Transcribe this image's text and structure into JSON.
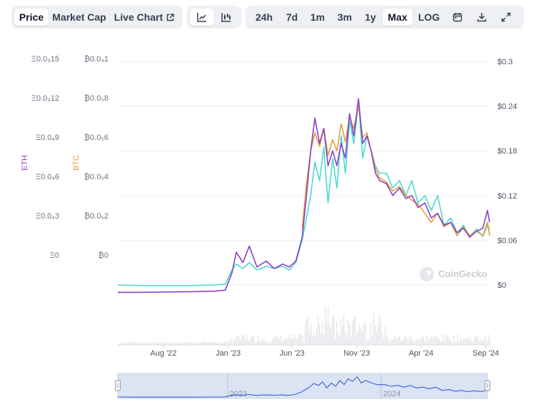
{
  "toolbar": {
    "tabs": [
      {
        "label": "Price",
        "active": true
      },
      {
        "label": "Market Cap",
        "active": false
      },
      {
        "label": "Live Chart",
        "active": false
      }
    ],
    "chart_types": [
      "line-chart-icon",
      "candlestick-icon"
    ],
    "ranges": [
      {
        "label": "24h",
        "active": false
      },
      {
        "label": "7d",
        "active": false
      },
      {
        "label": "1m",
        "active": false
      },
      {
        "label": "3m",
        "active": false
      },
      {
        "label": "1y",
        "active": false
      },
      {
        "label": "Max",
        "active": true
      },
      {
        "label": "LOG",
        "active": false
      }
    ],
    "tools": [
      "calendar-icon",
      "download-icon",
      "expand-icon"
    ]
  },
  "watermark": "CoinGecko",
  "colors": {
    "eth": "#8b3fc9",
    "btc": "#e0a03c",
    "usd": "#4dd9d0",
    "volume": "#e3e6ea",
    "navigator_fill": "#dbe4f3",
    "navigator_line": "#3d5bd9"
  },
  "chart_data": {
    "type": "line",
    "x_labels": [
      "Aug '22",
      "Jan '23",
      "Jun '23",
      "Nov '23",
      "Apr '24",
      "Sep '24"
    ],
    "x_label_positions": [
      "2022-08-01",
      "2023-01-01",
      "2023-06-01",
      "2023-11-01",
      "2024-04-01",
      "2024-09-01"
    ],
    "x_range": [
      "2022-04-15",
      "2024-09-10"
    ],
    "y_axis_usd": {
      "ticks": [
        "$0",
        "$0.06",
        "$0.12",
        "$0.18",
        "$0.24",
        "$0.3"
      ],
      "range": [
        0,
        0.3
      ]
    },
    "y_axis_btc": {
      "title": "BTC",
      "ticks": [
        "₿0",
        "₿0.0₅2",
        "₿0.0₅4",
        "₿0.0₅6",
        "₿0.0₅8",
        "₿0.0₄1"
      ],
      "range": [
        0,
        1e-05
      ]
    },
    "y_axis_eth": {
      "title": "ETH",
      "ticks": [
        "Ξ0",
        "Ξ0.0₄3",
        "Ξ0.0₄6",
        "Ξ0.0₄9",
        "Ξ0.0₃12",
        "Ξ0.0₃15"
      ],
      "range": [
        0,
        0.00015
      ]
    },
    "series": [
      {
        "name": "USD",
        "axis": "usd",
        "x": [
          "2022-04-15",
          "2022-06-01",
          "2022-08-01",
          "2022-10-01",
          "2022-12-01",
          "2022-12-25",
          "2023-01-10",
          "2023-01-20",
          "2023-02-05",
          "2023-02-20",
          "2023-03-10",
          "2023-04-01",
          "2023-04-20",
          "2023-05-10",
          "2023-05-25",
          "2023-06-10",
          "2023-06-25",
          "2023-07-05",
          "2023-07-15",
          "2023-07-25",
          "2023-08-05",
          "2023-08-15",
          "2023-08-25",
          "2023-09-05",
          "2023-09-15",
          "2023-09-25",
          "2023-10-05",
          "2023-10-15",
          "2023-10-25",
          "2023-11-05",
          "2023-11-15",
          "2023-11-25",
          "2023-12-05",
          "2023-12-15",
          "2023-12-25",
          "2024-01-10",
          "2024-01-25",
          "2024-02-10",
          "2024-02-25",
          "2024-03-10",
          "2024-03-25",
          "2024-04-10",
          "2024-04-25",
          "2024-05-10",
          "2024-05-25",
          "2024-06-10",
          "2024-06-25",
          "2024-07-10",
          "2024-07-25",
          "2024-08-10",
          "2024-08-25",
          "2024-09-05",
          "2024-09-10"
        ],
        "y": [
          0.0,
          -0.001,
          -0.001,
          -0.001,
          0.0,
          0.001,
          0.02,
          0.028,
          0.022,
          0.03,
          0.02,
          0.025,
          0.022,
          0.025,
          0.02,
          0.03,
          0.06,
          0.09,
          0.12,
          0.165,
          0.14,
          0.185,
          0.11,
          0.17,
          0.13,
          0.2,
          0.15,
          0.22,
          0.19,
          0.245,
          0.17,
          0.2,
          0.18,
          0.16,
          0.15,
          0.15,
          0.13,
          0.14,
          0.12,
          0.14,
          0.11,
          0.12,
          0.1,
          0.12,
          0.08,
          0.09,
          0.07,
          0.08,
          0.065,
          0.075,
          0.065,
          0.08,
          0.075
        ]
      },
      {
        "name": "BTC",
        "axis": "btc",
        "x": [
          "2023-06-25",
          "2023-07-05",
          "2023-07-15",
          "2023-07-25",
          "2023-08-05",
          "2023-08-15",
          "2023-08-25",
          "2023-09-05",
          "2023-09-15",
          "2023-09-25",
          "2023-10-05",
          "2023-10-15",
          "2023-10-25",
          "2023-11-05",
          "2023-11-15",
          "2023-11-25",
          "2023-12-05",
          "2023-12-15",
          "2023-12-25",
          "2024-01-10",
          "2024-01-25",
          "2024-02-10",
          "2024-02-25",
          "2024-03-10",
          "2024-03-25",
          "2024-04-10",
          "2024-04-25",
          "2024-05-10",
          "2024-05-25",
          "2024-06-10",
          "2024-06-25",
          "2024-07-10",
          "2024-07-25",
          "2024-08-10",
          "2024-08-25",
          "2024-09-05",
          "2024-09-10"
        ],
        "y": [
          2.5e-06,
          4.5e-06,
          6e-06,
          6.8e-06,
          6.2e-06,
          7e-06,
          5.8e-06,
          6.5e-06,
          6e-06,
          7.2e-06,
          6.4e-06,
          7.5e-06,
          7e-06,
          8e-06,
          6.6e-06,
          6.8e-06,
          6e-06,
          5.2e-06,
          4.8e-06,
          4.6e-06,
          4.2e-06,
          4.4e-06,
          4e-06,
          3.8e-06,
          3.6e-06,
          3.2e-06,
          2.8e-06,
          3.2e-06,
          2.6e-06,
          2.8e-06,
          2.2e-06,
          2.6e-06,
          2.2e-06,
          2.4e-06,
          2.2e-06,
          2.8e-06,
          2.2e-06
        ]
      },
      {
        "name": "ETH",
        "axis": "eth",
        "x": [
          "2022-04-15",
          "2022-06-01",
          "2022-08-01",
          "2022-10-01",
          "2022-12-01",
          "2022-12-25",
          "2023-01-10",
          "2023-01-20",
          "2023-02-05",
          "2023-02-20",
          "2023-03-10",
          "2023-04-01",
          "2023-04-20",
          "2023-05-10",
          "2023-05-25",
          "2023-06-10",
          "2023-06-25",
          "2023-07-05",
          "2023-07-15",
          "2023-07-25",
          "2023-08-05",
          "2023-08-15",
          "2023-08-25",
          "2023-09-05",
          "2023-09-15",
          "2023-09-25",
          "2023-10-05",
          "2023-10-15",
          "2023-10-25",
          "2023-11-05",
          "2023-11-15",
          "2023-11-25",
          "2023-12-05",
          "2023-12-15",
          "2023-12-25",
          "2024-01-10",
          "2024-01-25",
          "2024-02-10",
          "2024-02-25",
          "2024-03-10",
          "2024-03-25",
          "2024-04-10",
          "2024-04-25",
          "2024-05-10",
          "2024-05-25",
          "2024-06-10",
          "2024-06-25",
          "2024-07-10",
          "2024-07-25",
          "2024-08-10",
          "2024-08-25",
          "2024-09-05",
          "2024-09-10"
        ],
        "y": [
          -5e-06,
          -5e-06,
          -4.8e-06,
          -4.6e-06,
          -4.2e-06,
          -3.5e-06,
          8e-06,
          2.2e-05,
          1.5e-05,
          2.6e-05,
          1.2e-05,
          1.6e-05,
          1.1e-05,
          1.4e-05,
          1.2e-05,
          1.6e-05,
          3.2e-05,
          6e-05,
          9e-05,
          0.000112,
          9.5e-05,
          0.000105,
          8e-05,
          9e-05,
          8e-05,
          9.5e-05,
          8.5e-05,
          0.000115,
          0.0001,
          0.000125,
          9.5e-05,
          0.0001,
          9e-05,
          7.5e-05,
          7e-05,
          6.8e-05,
          6e-05,
          6.5e-05,
          5.8e-05,
          6e-05,
          5.2e-05,
          5.5e-05,
          4.5e-05,
          4.8e-05,
          4e-05,
          4.2e-05,
          3.5e-05,
          3.8e-05,
          3.2e-05,
          3.6e-05,
          3.8e-05,
          5e-05,
          4.2e-05
        ]
      }
    ],
    "grid": true,
    "legend": "none",
    "navigator": {
      "labels": [
        "2023",
        "2024"
      ],
      "label_positions": [
        "2023-01-01",
        "2024-01-01"
      ],
      "selection": [
        "2022-04-15",
        "2024-09-10"
      ]
    }
  }
}
